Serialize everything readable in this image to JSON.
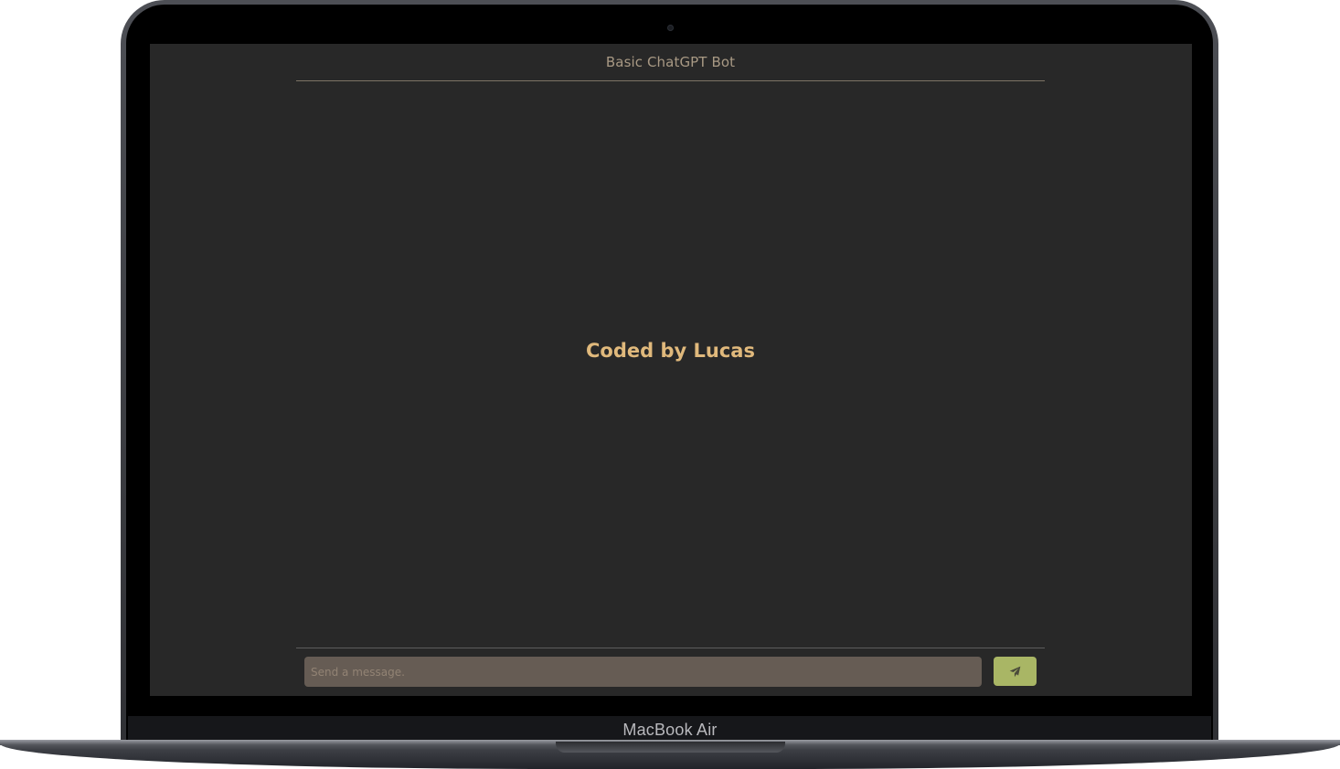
{
  "device": {
    "label": "MacBook Air"
  },
  "app": {
    "title": "Basic ChatGPT Bot",
    "credit": "Coded by Lucas",
    "composer": {
      "placeholder": "Send a message.",
      "value": "",
      "send_icon": "paper-plane-icon"
    }
  },
  "colors": {
    "background": "#282828",
    "title": "#a89984",
    "credit": "#e0b97c",
    "input_bg": "#665c54",
    "send_button": "#a9b665"
  }
}
